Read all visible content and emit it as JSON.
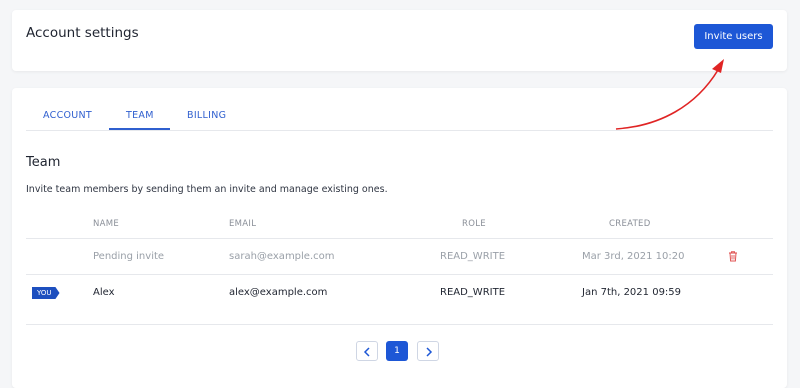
{
  "header": {
    "title": "Account settings",
    "invite_button": "Invite users"
  },
  "tabs": [
    {
      "label": "ACCOUNT"
    },
    {
      "label": "TEAM",
      "active": true
    },
    {
      "label": "BILLING"
    }
  ],
  "team": {
    "title": "Team",
    "description": "Invite team members by sending them an invite and manage existing ones."
  },
  "table": {
    "headers": {
      "name": "NAME",
      "email": "EMAIL",
      "role": "ROLE",
      "created": "CREATED"
    },
    "rows": [
      {
        "name": "Pending invite",
        "email": "sarah@example.com",
        "role": "READ_WRITE",
        "created": "Mar 3rd, 2021 10:20",
        "status": "pending",
        "deletable": true
      },
      {
        "name": "Alex",
        "email": "alex@example.com",
        "role": "READ_WRITE",
        "created": "Jan 7th, 2021 09:59",
        "badge": "YOU"
      }
    ]
  },
  "pagination": {
    "current_page": "1"
  },
  "colors": {
    "accent": "#1d57d6",
    "annotation_arrow": "#e02424",
    "delete_icon": "#e05252"
  },
  "icons": [
    "trash-icon",
    "chevron-left-icon",
    "chevron-right-icon",
    "annotation-arrow"
  ]
}
